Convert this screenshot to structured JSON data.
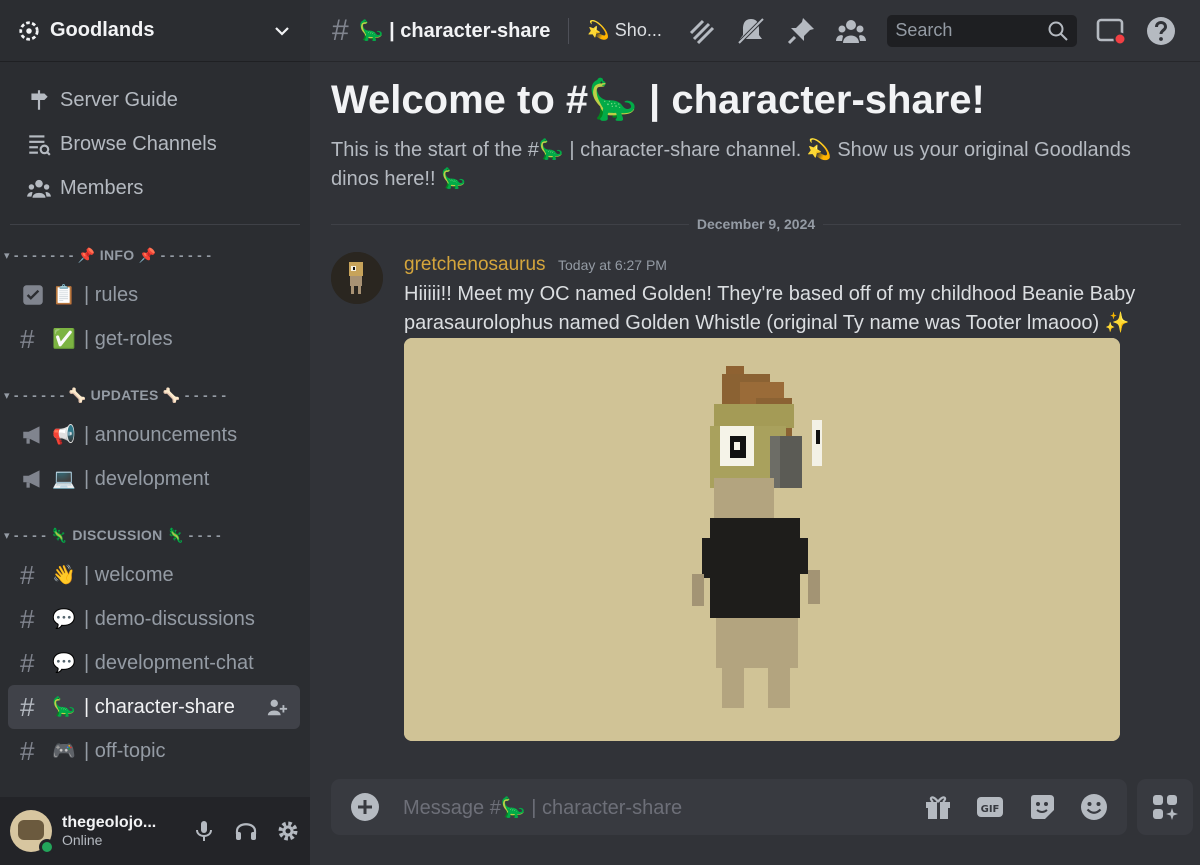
{
  "server": {
    "name": "Goodlands"
  },
  "guide": [
    {
      "label": "Server Guide",
      "icon": "signpost-icon"
    },
    {
      "label": "Browse Channels",
      "icon": "browse-icon"
    },
    {
      "label": "Members",
      "icon": "members-icon"
    }
  ],
  "categories": {
    "info": "- - - - - - - 📌 INFO 📌 - - - - - -",
    "updates": "- - - - - - 🦴 UPDATES 🦴 - - - - -",
    "discussion": "- - - - 🦎 DISCUSSION 🦎 - - - -"
  },
  "channels": {
    "rules": {
      "emoji": "📋",
      "label": "| rules"
    },
    "get_roles": {
      "emoji": "✅",
      "label": "| get-roles"
    },
    "announcements": {
      "emoji": "📢",
      "label": "| announcements"
    },
    "development": {
      "emoji": "💻",
      "label": "| development"
    },
    "welcome": {
      "emoji": "👋",
      "label": "| welcome"
    },
    "demo_discussions": {
      "emoji": "💬",
      "label": "| demo-discussions"
    },
    "development_chat": {
      "emoji": "💬",
      "label": "| development-chat"
    },
    "character_share": {
      "emoji": "🦕",
      "label": "| character-share"
    },
    "off_topic": {
      "emoji": "🎮",
      "label": "| off-topic"
    }
  },
  "hash_symbol": "#",
  "user": {
    "name": "thegeolojo...",
    "status": "Online"
  },
  "topbar": {
    "channel_name": "🦕 | character-share",
    "topic": "💫 Sho..."
  },
  "search": {
    "placeholder": "Search"
  },
  "welcome": {
    "title": "Welcome to #🦕 | character-share!",
    "description": "This is the start of the #🦕 | character-share channel. 💫 Show us your original Goodlands dinos here!! 🦕"
  },
  "date_divider": "December 9, 2024",
  "message": {
    "author": "gretchenosaurus",
    "timestamp": "Today at 6:27 PM",
    "text": "Hiiiii!! Meet my OC named Golden! They're based off of my childhood Beanie Baby parasaurolophus named Golden Whistle (original Ty name was Tooter lmaooo) ✨"
  },
  "composer": {
    "placeholder": "Message #🦕 | character-share"
  },
  "colors": {
    "accent_author": "#d4a53c",
    "online": "#23a55a",
    "attachment_bg": "#d0c396"
  }
}
